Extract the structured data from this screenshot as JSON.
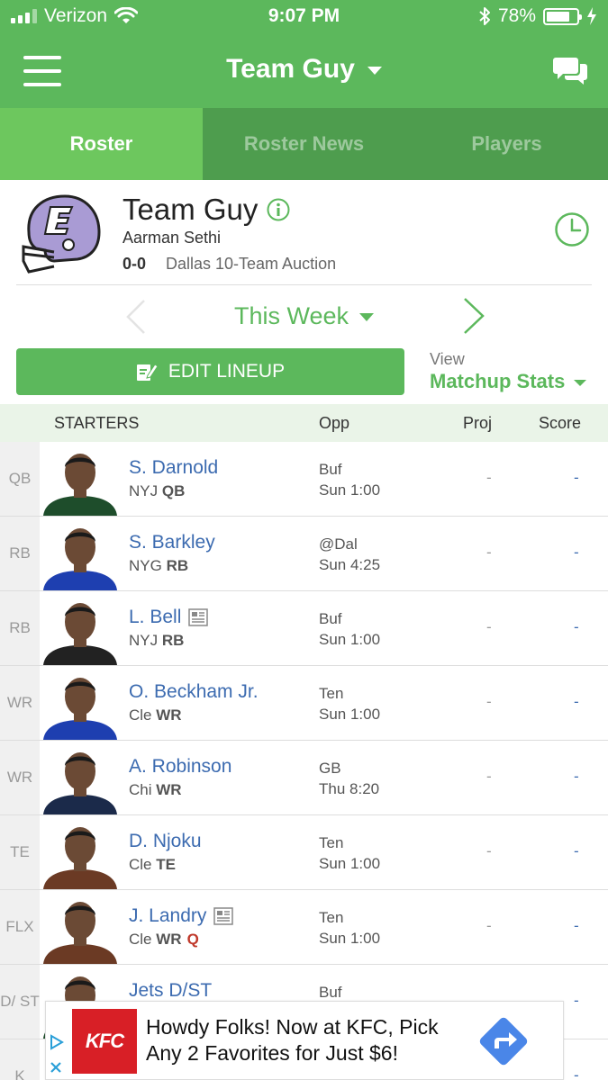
{
  "status_bar": {
    "carrier": "Verizon",
    "time": "9:07 PM",
    "battery": "78%",
    "battery_level": 0.78
  },
  "header": {
    "title": "Team Guy"
  },
  "tabs": [
    {
      "label": "Roster",
      "active": true
    },
    {
      "label": "Roster News",
      "active": false
    },
    {
      "label": "Players",
      "active": false
    }
  ],
  "team": {
    "name": "Team Guy",
    "owner": "Aarman Sethi",
    "record": "0-0",
    "league": "Dallas 10-Team Auction",
    "helmet_color": "#a99bd4",
    "accent_color": "#5cb85c"
  },
  "week": {
    "label": "This Week"
  },
  "actions": {
    "edit_lineup": "EDIT LINEUP",
    "view_label": "View",
    "view_value": "Matchup Stats"
  },
  "table": {
    "section": "STARTERS",
    "col_opp": "Opp",
    "col_proj": "Proj",
    "col_score": "Score"
  },
  "players": [
    {
      "pos": "QB",
      "name": "S. Darnold",
      "team": "NYJ",
      "position": "QB",
      "status": "",
      "opp": "Buf",
      "game_time": "Sun 1:00",
      "proj": "-",
      "score": "-",
      "news": false,
      "jersey": "#1e4d2b"
    },
    {
      "pos": "RB",
      "name": "S. Barkley",
      "team": "NYG",
      "position": "RB",
      "status": "",
      "opp": "@Dal",
      "game_time": "Sun 4:25",
      "proj": "-",
      "score": "-",
      "news": false,
      "jersey": "#1e3fb0"
    },
    {
      "pos": "RB",
      "name": "L. Bell",
      "team": "NYJ",
      "position": "RB",
      "status": "",
      "opp": "Buf",
      "game_time": "Sun 1:00",
      "proj": "-",
      "score": "-",
      "news": true,
      "jersey": "#222222"
    },
    {
      "pos": "WR",
      "name": "O. Beckham Jr.",
      "team": "Cle",
      "position": "WR",
      "status": "",
      "opp": "Ten",
      "game_time": "Sun 1:00",
      "proj": "-",
      "score": "-",
      "news": false,
      "jersey": "#1e3fb0"
    },
    {
      "pos": "WR",
      "name": "A. Robinson",
      "team": "Chi",
      "position": "WR",
      "status": "",
      "opp": "GB",
      "game_time": "Thu 8:20",
      "proj": "-",
      "score": "-",
      "news": false,
      "jersey": "#1b2a4a"
    },
    {
      "pos": "TE",
      "name": "D. Njoku",
      "team": "Cle",
      "position": "TE",
      "status": "",
      "opp": "Ten",
      "game_time": "Sun 1:00",
      "proj": "-",
      "score": "-",
      "news": false,
      "jersey": "#6b3a24"
    },
    {
      "pos": "FLX",
      "name": "J. Landry",
      "team": "Cle",
      "position": "WR",
      "status": "Q",
      "opp": "Ten",
      "game_time": "Sun 1:00",
      "proj": "-",
      "score": "-",
      "news": true,
      "jersey": "#6b3a24"
    },
    {
      "pos": "D/ ST",
      "name": "Jets D/ST",
      "team": "",
      "position": "",
      "status": "",
      "opp": "Buf",
      "game_time": "",
      "proj": "",
      "score": "-",
      "news": false,
      "jersey": "#1e4d2b"
    },
    {
      "pos": "K",
      "name": "",
      "team": "",
      "position": "",
      "status": "",
      "opp": "",
      "game_time": "",
      "proj": "",
      "score": "-",
      "news": false,
      "jersey": ""
    }
  ],
  "ad": {
    "brand": "KFC",
    "text": "Howdy Folks! Now at KFC, Pick Any 2 Favorites for Just $6!",
    "brand_color": "#d81f26",
    "arrow_color": "#4a86e8"
  }
}
